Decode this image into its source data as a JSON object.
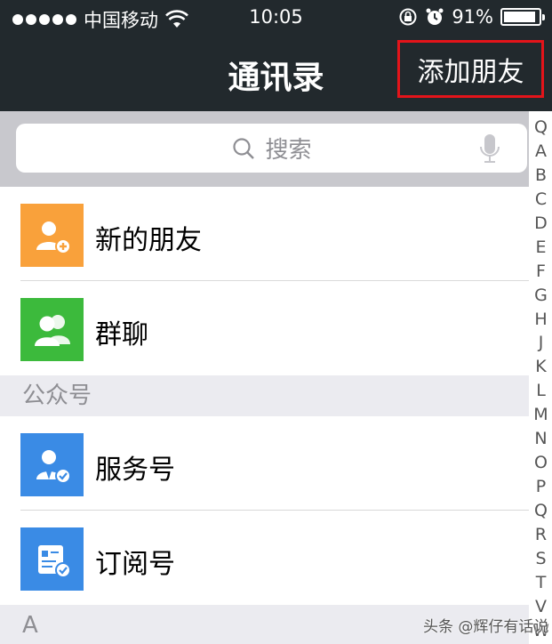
{
  "status_bar": {
    "carrier": "中国移动",
    "time": "10:05",
    "battery": "91%",
    "battery_level": 0.91
  },
  "nav": {
    "title": "通讯录",
    "add_friend": "添加朋友"
  },
  "search": {
    "placeholder": "搜索"
  },
  "top_items": [
    {
      "label": "新的朋友",
      "icon": "new-friend-icon",
      "color": "#f9a13b"
    },
    {
      "label": "群聊",
      "icon": "group-chat-icon",
      "color": "#3cba3c"
    }
  ],
  "public_section": {
    "header": "公众号",
    "items": [
      {
        "label": "服务号",
        "icon": "service-account-icon",
        "color": "#3a8be5"
      },
      {
        "label": "订阅号",
        "icon": "subscription-account-icon",
        "color": "#3a8be5"
      }
    ]
  },
  "a_section": {
    "header": "A"
  },
  "index_letters": [
    "Q",
    "A",
    "B",
    "C",
    "D",
    "E",
    "F",
    "G",
    "H",
    "J",
    "K",
    "L",
    "M",
    "N",
    "O",
    "P",
    "Q",
    "R",
    "S",
    "T",
    "V",
    "W"
  ],
  "watermark": "头条 @辉仔有话说",
  "colors": {
    "nav_bg": "#22292d",
    "highlight": "#e4141a"
  }
}
